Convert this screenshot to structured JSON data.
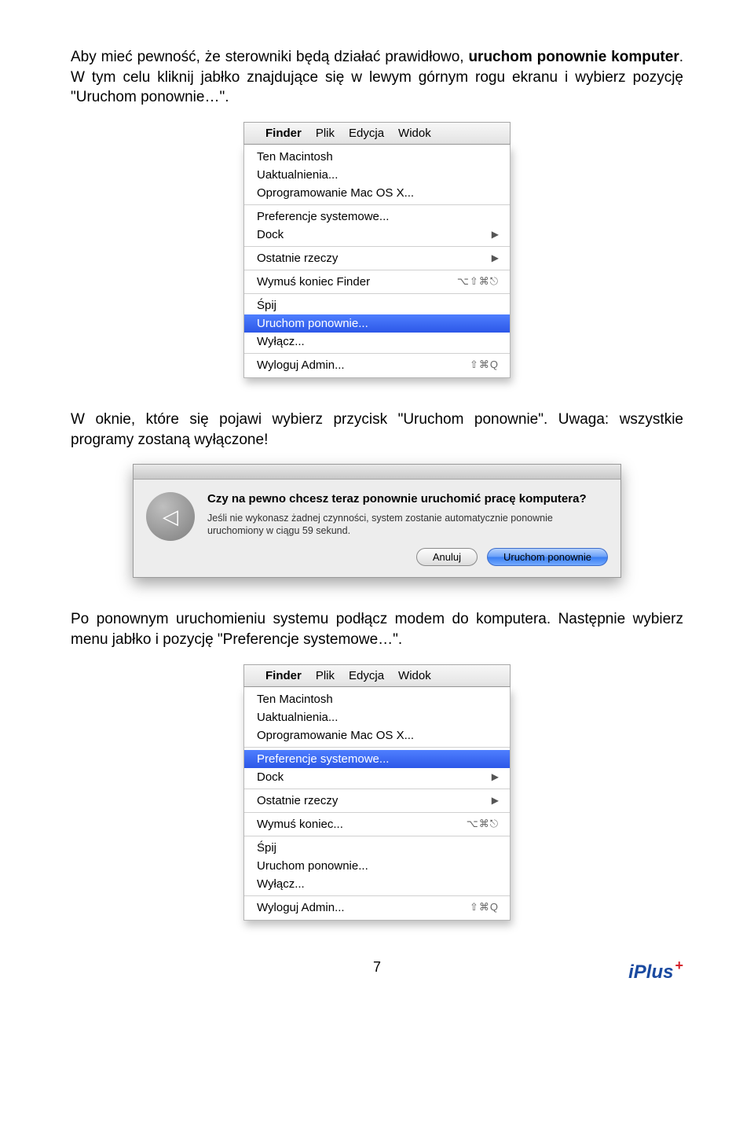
{
  "para1_a": "Aby mieć pewność, że sterowniki będą działać prawidłowo, ",
  "para1_b": "uruchom ponownie komputer",
  "para1_c": ". W tym celu kliknij jabłko znajdujące się w lewym górnym rogu ekranu i wybierz pozycję \"Uruchom ponownie…\".",
  "menubar": {
    "items": [
      "Finder",
      "Plik",
      "Edycja",
      "Widok"
    ]
  },
  "menu1": {
    "items": [
      {
        "label": "Ten Macintosh"
      },
      {
        "label": "Uaktualnienia..."
      },
      {
        "label": "Oprogramowanie Mac OS X..."
      },
      {
        "sep": true
      },
      {
        "label": "Preferencje systemowe..."
      },
      {
        "label": "Dock",
        "sub": true
      },
      {
        "sep": true
      },
      {
        "label": "Ostatnie rzeczy",
        "sub": true
      },
      {
        "sep": true
      },
      {
        "label": "Wymuś koniec Finder",
        "shortcut": "⌥⇧⌘⎋"
      },
      {
        "sep": true
      },
      {
        "label": "Śpij"
      },
      {
        "label": "Uruchom ponownie...",
        "hl": true
      },
      {
        "label": "Wyłącz..."
      },
      {
        "sep": true
      },
      {
        "label": "Wyloguj Admin...",
        "shortcut": "⇧⌘Q"
      }
    ]
  },
  "para2": "W oknie, które się pojawi wybierz przycisk \"Uruchom ponownie\". Uwaga: wszystkie programy zostaną wyłączone!",
  "dialog": {
    "title": "Czy na pewno chcesz teraz ponownie uruchomić pracę komputera?",
    "body": "Jeśli nie wykonasz żadnej czynności, system zostanie automatycznie ponownie uruchomiony w ciągu 59 sekund.",
    "cancel": "Anuluj",
    "ok": "Uruchom ponownie"
  },
  "para3": "Po ponownym uruchomieniu systemu podłącz modem do komputera. Następnie wybierz menu jabłko i pozycję \"Preferencje systemowe…\".",
  "menu2": {
    "items": [
      {
        "label": "Ten Macintosh"
      },
      {
        "label": "Uaktualnienia..."
      },
      {
        "label": "Oprogramowanie Mac OS X..."
      },
      {
        "sep": true
      },
      {
        "label": "Preferencje systemowe...",
        "hl": true
      },
      {
        "label": "Dock",
        "sub": true
      },
      {
        "sep": true
      },
      {
        "label": "Ostatnie rzeczy",
        "sub": true
      },
      {
        "sep": true
      },
      {
        "label": "Wymuś koniec...",
        "shortcut": "⌥⌘⎋"
      },
      {
        "sep": true
      },
      {
        "label": "Śpij"
      },
      {
        "label": "Uruchom ponownie..."
      },
      {
        "label": "Wyłącz..."
      },
      {
        "sep": true
      },
      {
        "label": "Wyloguj Admin...",
        "shortcut": "⇧⌘Q"
      }
    ]
  },
  "page_number": "7",
  "logo_text": "iPlus"
}
